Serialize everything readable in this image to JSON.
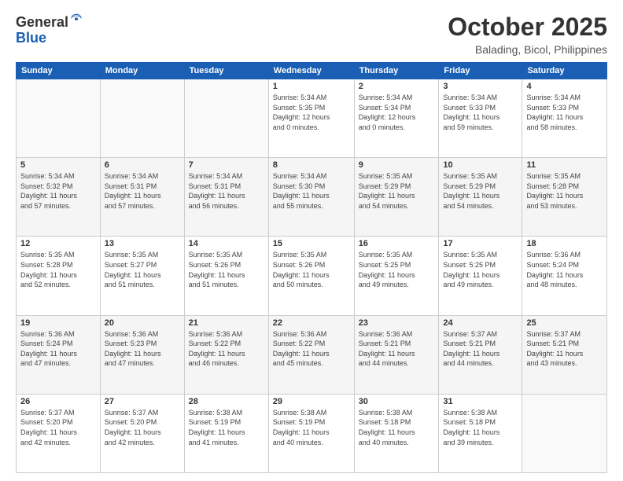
{
  "header": {
    "logo_line1": "General",
    "logo_line2": "Blue",
    "month": "October 2025",
    "location": "Balading, Bicol, Philippines"
  },
  "weekdays": [
    "Sunday",
    "Monday",
    "Tuesday",
    "Wednesday",
    "Thursday",
    "Friday",
    "Saturday"
  ],
  "weeks": [
    [
      {
        "day": "",
        "info": ""
      },
      {
        "day": "",
        "info": ""
      },
      {
        "day": "",
        "info": ""
      },
      {
        "day": "1",
        "info": "Sunrise: 5:34 AM\nSunset: 5:35 PM\nDaylight: 12 hours\nand 0 minutes."
      },
      {
        "day": "2",
        "info": "Sunrise: 5:34 AM\nSunset: 5:34 PM\nDaylight: 12 hours\nand 0 minutes."
      },
      {
        "day": "3",
        "info": "Sunrise: 5:34 AM\nSunset: 5:33 PM\nDaylight: 11 hours\nand 59 minutes."
      },
      {
        "day": "4",
        "info": "Sunrise: 5:34 AM\nSunset: 5:33 PM\nDaylight: 11 hours\nand 58 minutes."
      }
    ],
    [
      {
        "day": "5",
        "info": "Sunrise: 5:34 AM\nSunset: 5:32 PM\nDaylight: 11 hours\nand 57 minutes."
      },
      {
        "day": "6",
        "info": "Sunrise: 5:34 AM\nSunset: 5:31 PM\nDaylight: 11 hours\nand 57 minutes."
      },
      {
        "day": "7",
        "info": "Sunrise: 5:34 AM\nSunset: 5:31 PM\nDaylight: 11 hours\nand 56 minutes."
      },
      {
        "day": "8",
        "info": "Sunrise: 5:34 AM\nSunset: 5:30 PM\nDaylight: 11 hours\nand 55 minutes."
      },
      {
        "day": "9",
        "info": "Sunrise: 5:35 AM\nSunset: 5:29 PM\nDaylight: 11 hours\nand 54 minutes."
      },
      {
        "day": "10",
        "info": "Sunrise: 5:35 AM\nSunset: 5:29 PM\nDaylight: 11 hours\nand 54 minutes."
      },
      {
        "day": "11",
        "info": "Sunrise: 5:35 AM\nSunset: 5:28 PM\nDaylight: 11 hours\nand 53 minutes."
      }
    ],
    [
      {
        "day": "12",
        "info": "Sunrise: 5:35 AM\nSunset: 5:28 PM\nDaylight: 11 hours\nand 52 minutes."
      },
      {
        "day": "13",
        "info": "Sunrise: 5:35 AM\nSunset: 5:27 PM\nDaylight: 11 hours\nand 51 minutes."
      },
      {
        "day": "14",
        "info": "Sunrise: 5:35 AM\nSunset: 5:26 PM\nDaylight: 11 hours\nand 51 minutes."
      },
      {
        "day": "15",
        "info": "Sunrise: 5:35 AM\nSunset: 5:26 PM\nDaylight: 11 hours\nand 50 minutes."
      },
      {
        "day": "16",
        "info": "Sunrise: 5:35 AM\nSunset: 5:25 PM\nDaylight: 11 hours\nand 49 minutes."
      },
      {
        "day": "17",
        "info": "Sunrise: 5:35 AM\nSunset: 5:25 PM\nDaylight: 11 hours\nand 49 minutes."
      },
      {
        "day": "18",
        "info": "Sunrise: 5:36 AM\nSunset: 5:24 PM\nDaylight: 11 hours\nand 48 minutes."
      }
    ],
    [
      {
        "day": "19",
        "info": "Sunrise: 5:36 AM\nSunset: 5:24 PM\nDaylight: 11 hours\nand 47 minutes."
      },
      {
        "day": "20",
        "info": "Sunrise: 5:36 AM\nSunset: 5:23 PM\nDaylight: 11 hours\nand 47 minutes."
      },
      {
        "day": "21",
        "info": "Sunrise: 5:36 AM\nSunset: 5:22 PM\nDaylight: 11 hours\nand 46 minutes."
      },
      {
        "day": "22",
        "info": "Sunrise: 5:36 AM\nSunset: 5:22 PM\nDaylight: 11 hours\nand 45 minutes."
      },
      {
        "day": "23",
        "info": "Sunrise: 5:36 AM\nSunset: 5:21 PM\nDaylight: 11 hours\nand 44 minutes."
      },
      {
        "day": "24",
        "info": "Sunrise: 5:37 AM\nSunset: 5:21 PM\nDaylight: 11 hours\nand 44 minutes."
      },
      {
        "day": "25",
        "info": "Sunrise: 5:37 AM\nSunset: 5:21 PM\nDaylight: 11 hours\nand 43 minutes."
      }
    ],
    [
      {
        "day": "26",
        "info": "Sunrise: 5:37 AM\nSunset: 5:20 PM\nDaylight: 11 hours\nand 42 minutes."
      },
      {
        "day": "27",
        "info": "Sunrise: 5:37 AM\nSunset: 5:20 PM\nDaylight: 11 hours\nand 42 minutes."
      },
      {
        "day": "28",
        "info": "Sunrise: 5:38 AM\nSunset: 5:19 PM\nDaylight: 11 hours\nand 41 minutes."
      },
      {
        "day": "29",
        "info": "Sunrise: 5:38 AM\nSunset: 5:19 PM\nDaylight: 11 hours\nand 40 minutes."
      },
      {
        "day": "30",
        "info": "Sunrise: 5:38 AM\nSunset: 5:18 PM\nDaylight: 11 hours\nand 40 minutes."
      },
      {
        "day": "31",
        "info": "Sunrise: 5:38 AM\nSunset: 5:18 PM\nDaylight: 11 hours\nand 39 minutes."
      },
      {
        "day": "",
        "info": ""
      }
    ]
  ]
}
